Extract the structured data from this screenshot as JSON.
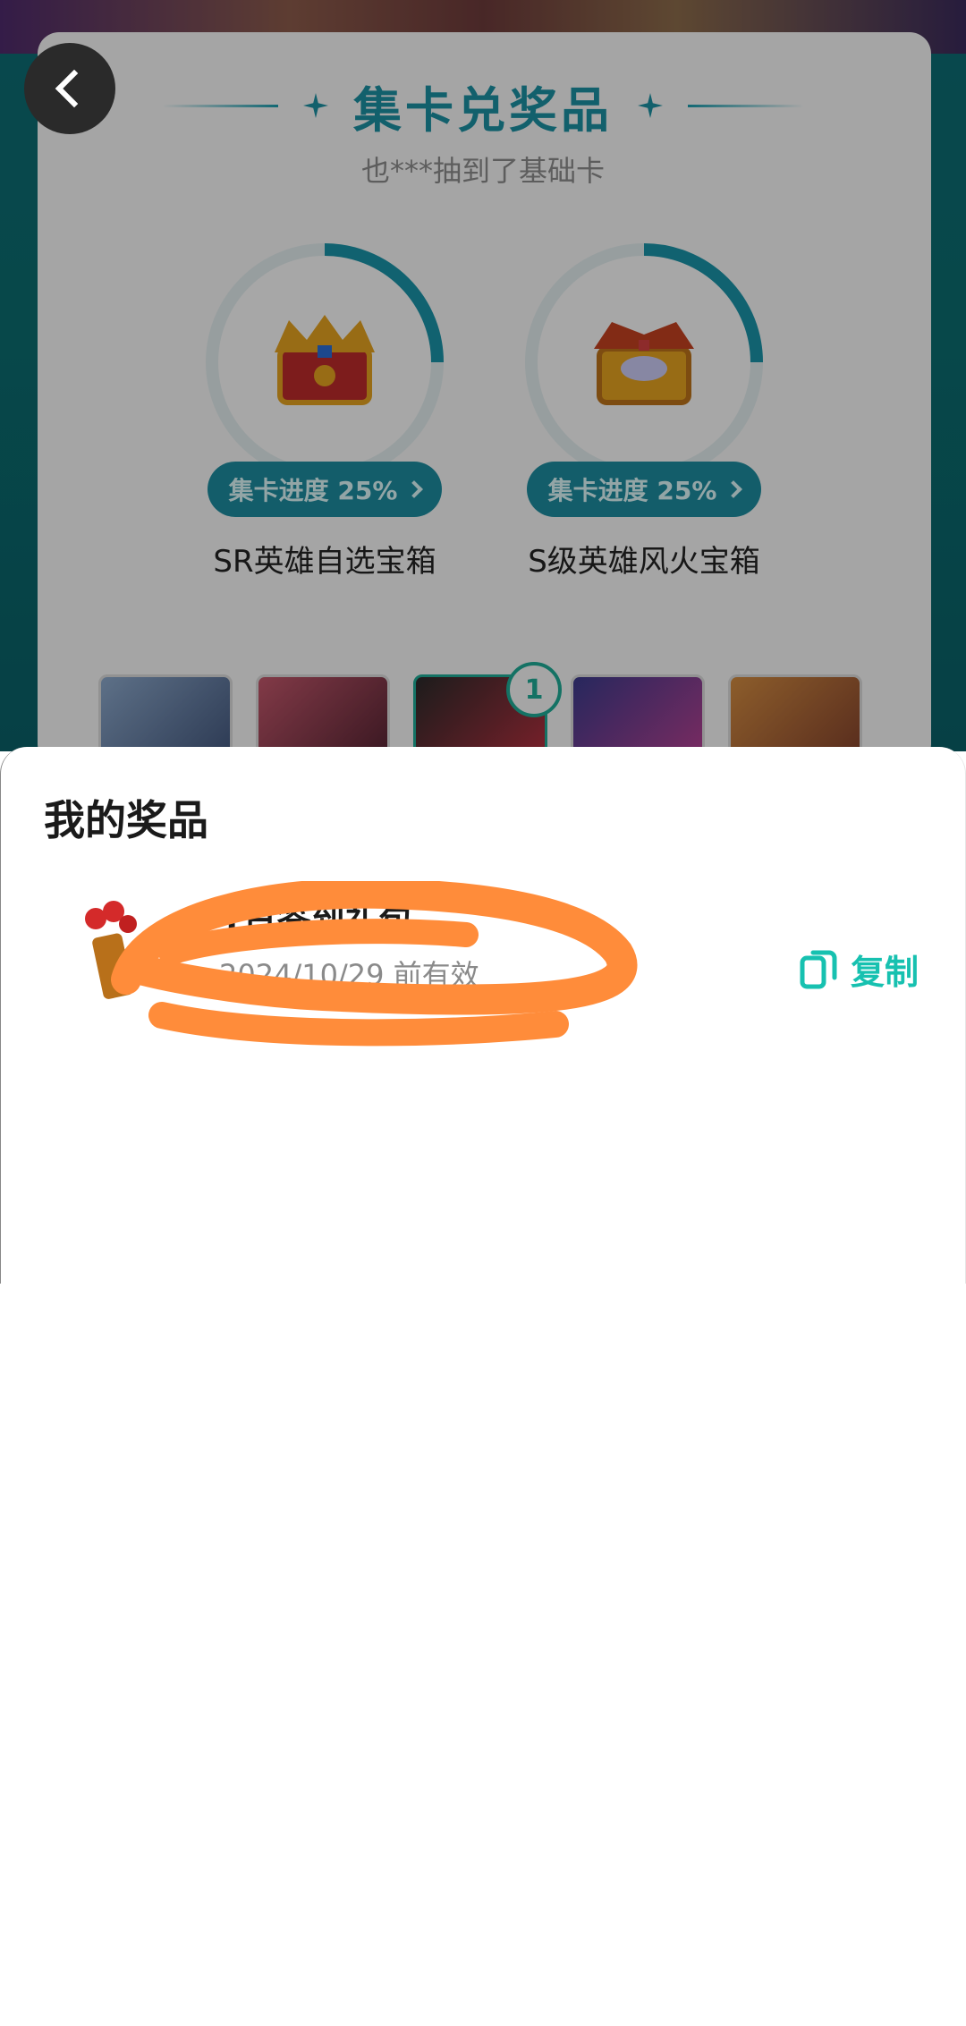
{
  "header": {
    "title": "集卡兑奖品",
    "subtitle": "也***抽到了基础卡"
  },
  "chests": [
    {
      "name": "SR英雄自选宝箱",
      "progress_label": "集卡进度 25%",
      "progress": 0.25
    },
    {
      "name": "S级英雄风火宝箱",
      "progress_label": "集卡进度 25%",
      "progress": 0.25
    }
  ],
  "hero_cards": {
    "selected_count": "1"
  },
  "sheet": {
    "title": "我的奖品",
    "prize": {
      "name": "1日签到礼包",
      "expire": "2024/10/29 前有效",
      "copy_label": "复制"
    }
  },
  "icons": {
    "back": "back-arrow-icon",
    "copy": "copy-icon",
    "title_decor": "sparkle-icon"
  },
  "colors": {
    "accent": "#17c1b0",
    "title": "#1b8ea0",
    "scribble": "#ff8c3a"
  }
}
